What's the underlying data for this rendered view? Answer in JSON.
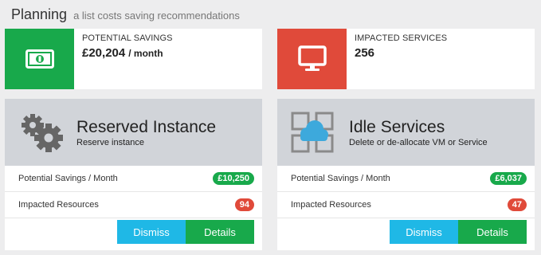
{
  "header": {
    "title": "Planning",
    "subtitle": "a list costs saving recommendations"
  },
  "summary": {
    "savings": {
      "label": "POTENTIAL SAVINGS",
      "value": "£20,204",
      "unit": "/ month",
      "icon": "money-icon",
      "color": "#18a94b"
    },
    "services": {
      "label": "IMPACTED SERVICES",
      "value": "256",
      "icon": "monitor-icon",
      "color": "#e04a3a"
    }
  },
  "cards": [
    {
      "title": "Reserved Instance",
      "subtitle": "Reserve instance",
      "icon": "gears-icon",
      "rows": [
        {
          "label": "Potential Savings / Month",
          "value": "£10,250",
          "color": "#18a94b"
        },
        {
          "label": "Impacted Resources",
          "value": "94",
          "color": "#e04a3a"
        }
      ],
      "dismiss_label": "Dismiss",
      "details_label": "Details"
    },
    {
      "title": "Idle Services",
      "subtitle": "Delete or de-allocate VM or Service",
      "icon": "cloud-icon",
      "rows": [
        {
          "label": "Potential Savings / Month",
          "value": "£6,037",
          "color": "#18a94b"
        },
        {
          "label": "Impacted Resources",
          "value": "47",
          "color": "#e04a3a"
        }
      ],
      "dismiss_label": "Dismiss",
      "details_label": "Details"
    }
  ],
  "colors": {
    "dismiss": "#1fb8e6",
    "details": "#18a94b",
    "header_bg": "#d1d4d9"
  }
}
